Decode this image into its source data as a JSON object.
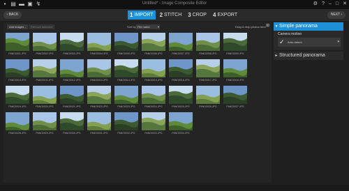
{
  "window": {
    "title": "Untitled* - Image Composite Editor"
  },
  "titlebar_icons": [
    "new-icon",
    "open-icon",
    "save-icon",
    "export-icon",
    "share-icon"
  ],
  "window_controls": {
    "settings": "⚙",
    "help": "?",
    "minimize": "–",
    "maximize": "□",
    "close": "✕"
  },
  "nav": {
    "back_label": "BACK",
    "next_label": "NEXT"
  },
  "steps": [
    {
      "num": "1",
      "label": "IMPORT",
      "active": true
    },
    {
      "num": "2",
      "label": "STITCH",
      "active": false
    },
    {
      "num": "3",
      "label": "CROP",
      "active": false
    },
    {
      "num": "4",
      "label": "EXPORT",
      "active": false
    }
  ],
  "toolbar": {
    "add_images": "Add images...",
    "remove_selected": "Remove selected",
    "sort_label": "Sort by",
    "sort_value": "File name",
    "drop_hint": "Drag & drop photos here"
  },
  "images": [
    "PANO0001.JPG",
    "PANO0002.JPG",
    "PANO0003.JPG",
    "PANO0004.JPG",
    "PANO0005.JPG",
    "PANO0006.JPG",
    "PANO0007.JPG",
    "PANO0008.JPG",
    "PANO0009.JPG",
    "PANO0010.JPG",
    "PANO0011.JPG",
    "PANO0012.JPG",
    "PANO0013.JPG",
    "PANO0014.JPG",
    "PANO0015.JPG",
    "PANO0016.JPG",
    "PANO0017.JPG",
    "PANO0018.JPG",
    "PANO0019.JPG",
    "PANO0020.JPG",
    "PANO0021.JPG",
    "PANO0022.JPG",
    "PANO0023.JPG",
    "PANO0024.JPG",
    "PANO0025.JPG",
    "PANO0026.JPG",
    "PANO0027.JPG",
    "PANO0028.JPG",
    "PANO0029.JPG",
    "PANO0030.JPG",
    "PANO0031.JPG",
    "PANO0032.JPG",
    "PANO0033.JPG",
    "PANO0034.JPG"
  ],
  "side_panel": {
    "simple_title": "Simple panorama",
    "camera_motion_label": "Camera motion",
    "camera_motion_value": "Auto-detect",
    "structured_title": "Structured panorama"
  },
  "colors": {
    "accent": "#1e90d8",
    "background": "#1f1f1f"
  }
}
